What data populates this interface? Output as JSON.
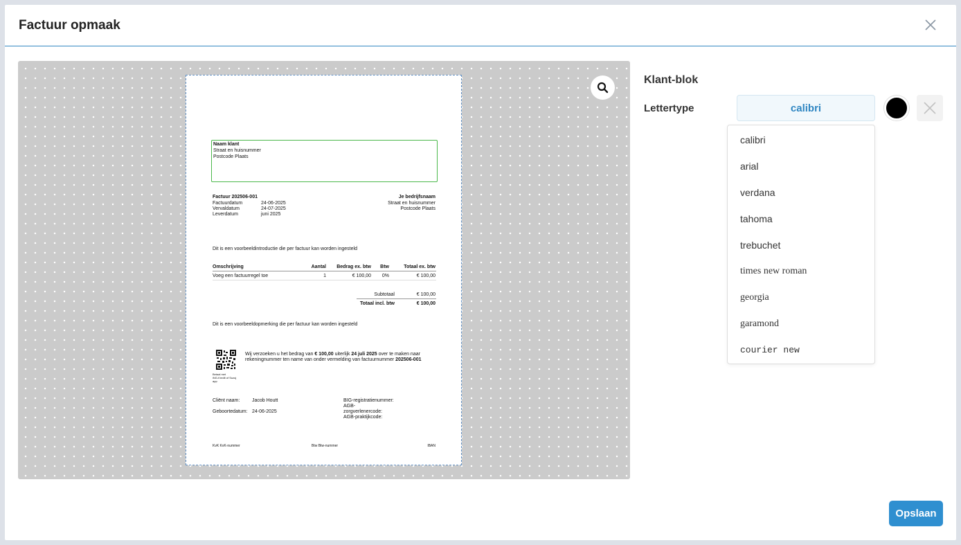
{
  "modal": {
    "title": "Factuur opmaak"
  },
  "panel": {
    "section_title": "Klant-blok",
    "font_label": "Lettertype",
    "selected_font": "calibri",
    "font_color": "#000000",
    "font_options": [
      "calibri",
      "arial",
      "verdana",
      "tahoma",
      "trebuchet",
      "times new roman",
      "georgia",
      "garamond",
      "courier new"
    ]
  },
  "save_label": "Opslaan",
  "invoice": {
    "client": {
      "name": "Naam klant",
      "street": "Straat en huisnummer",
      "postal": "Postcode Plaats"
    },
    "number_label": "Factuur 202506-001",
    "meta": [
      {
        "label": "Factuurdatum",
        "value": "24-06-2025"
      },
      {
        "label": "Vervaldatum",
        "value": "24-07-2025"
      },
      {
        "label": "Leverdatum",
        "value": "juni 2025"
      }
    ],
    "company": {
      "name": "Je bedrijfsnaam",
      "street": "Straat en huisnummer",
      "postal": "Postcode Plaats"
    },
    "intro": "Dit is een voorbeeldintroductie die per factuur kan worden ingesteld",
    "table_headers": {
      "desc": "Omschrijving",
      "qty": "Aantal",
      "amount": "Bedrag ex. btw",
      "vat": "Btw",
      "total": "Totaal ex. btw"
    },
    "row": {
      "desc": "Voeg een factuurregel toe",
      "qty": "1",
      "amount": "€ 100,00",
      "vat": "0%",
      "total": "€ 100,00"
    },
    "subtotal_label": "Subtotaal",
    "subtotal_value": "€ 100,00",
    "total_label": "Totaal incl. btw",
    "total_value": "€ 100,00",
    "remark": "Dit is een voorbeeldopmerking die per factuur kan worden ingesteld",
    "pay_line1_a": "Wij verzoeken u het bedrag van ",
    "pay_amount": "€ 100,00",
    "pay_line1_b": " uiterlijk ",
    "pay_date": "24 juli 2025",
    "pay_line1_c": " over te maken naar",
    "pay_line2_a": "rekeningnummer ten name van onder vermelding van factuurnummer ",
    "pay_number": "202506-001",
    "qr_caption": [
      "Betaal met",
      "iNG-Kredit of Suzuj",
      "app"
    ],
    "patient_label": "Cliënt naam:",
    "patient_value": "Jacob Houtt",
    "birth_label": "Geboortedatum:",
    "birth_value": "24-06-2025",
    "big_label": "BIG-registratienummer:",
    "agb1_label": "AGB-",
    "agb2_label": "zorgverlenercode:",
    "agb3_label": "AGB-praktijkcode:",
    "footer": {
      "kvk": "KvK KvK-nummer",
      "btw": "Btw Btw-nummer",
      "iban": "IBAN"
    }
  }
}
